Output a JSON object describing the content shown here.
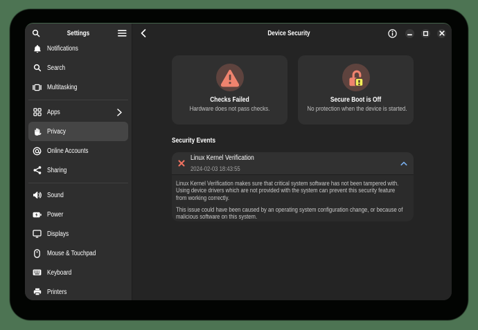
{
  "desktop": {
    "background_color": "#4d7453"
  },
  "sidebar": {
    "title": "Settings",
    "header_icons": [
      "search",
      "main-menu"
    ],
    "items": [
      {
        "type": "row",
        "icon": "bell",
        "label": "Notifications"
      },
      {
        "type": "row",
        "icon": "search",
        "label": "Search"
      },
      {
        "type": "row",
        "icon": "multitasking",
        "label": "Multitasking"
      },
      {
        "type": "separator"
      },
      {
        "type": "row",
        "icon": "apps",
        "label": "Apps",
        "chevron": true
      },
      {
        "type": "row",
        "icon": "hand",
        "label": "Privacy",
        "selected": true
      },
      {
        "type": "row",
        "icon": "at",
        "label": "Online Accounts"
      },
      {
        "type": "row",
        "icon": "share",
        "label": "Sharing"
      },
      {
        "type": "separator"
      },
      {
        "type": "row",
        "icon": "sound",
        "label": "Sound"
      },
      {
        "type": "row",
        "icon": "power",
        "label": "Power"
      },
      {
        "type": "row",
        "icon": "display",
        "label": "Displays"
      },
      {
        "type": "row",
        "icon": "mouse",
        "label": "Mouse & Touchpad"
      },
      {
        "type": "row",
        "icon": "keyboard",
        "label": "Keyboard"
      },
      {
        "type": "row",
        "icon": "printer",
        "label": "Printers"
      }
    ]
  },
  "content": {
    "title": "Device Security",
    "header_icons": [
      "back",
      "info",
      "minimize",
      "maximize",
      "close"
    ],
    "cards": [
      {
        "icon": "warning-triangle",
        "title": "Checks Failed",
        "subtitle": "Hardware does not pass checks."
      },
      {
        "icon": "lock-open-warning",
        "title": "Secure Boot is Off",
        "subtitle": "No protection when the device is started."
      }
    ],
    "section_heading": "Security Events",
    "event": {
      "icon": "fail-cross",
      "title": "Linux Kernel Verification",
      "timestamp": "2024-02-03 18:43:55",
      "expanded": true,
      "paragraphs": [
        "Linux Kernel Verification makes sure that critical system software has not been tampered with. Using device drivers which are not provided with the system can prevent this security feature from working correctly.",
        "This issue could have been caused by an operating system configuration change, or because of malicious software on this system."
      ]
    }
  },
  "colors": {
    "accent_blue": "#78aeed",
    "warning_salmon": "#f0836e",
    "warning_badge_yellow": "#f3ef59",
    "icon_circle_brown": "#5e433e"
  }
}
